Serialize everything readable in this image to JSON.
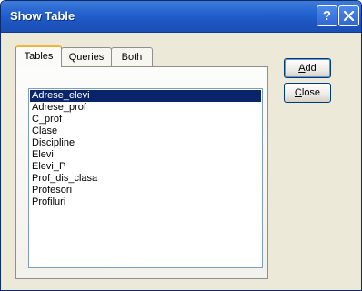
{
  "window": {
    "title": "Show Table",
    "help_label": "?"
  },
  "tabs": [
    {
      "label": "Tables",
      "active": true
    },
    {
      "label": "Queries",
      "active": false
    },
    {
      "label": "Both",
      "active": false
    }
  ],
  "table_list": {
    "items": [
      "Adrese_elevi",
      "Adrese_prof",
      "C_prof",
      "Clase",
      "Discipline",
      "Elevi",
      "Elevi_P",
      "Prof_dis_clasa",
      "Profesori",
      "Profiluri"
    ],
    "selected_index": 0
  },
  "buttons": {
    "add": {
      "accel": "A",
      "rest": "dd"
    },
    "close": {
      "accel": "C",
      "rest": "lose"
    }
  },
  "colors": {
    "title_bar": "#2462cf",
    "selection": "#0a246a",
    "dialog_face": "#ece9d8"
  }
}
